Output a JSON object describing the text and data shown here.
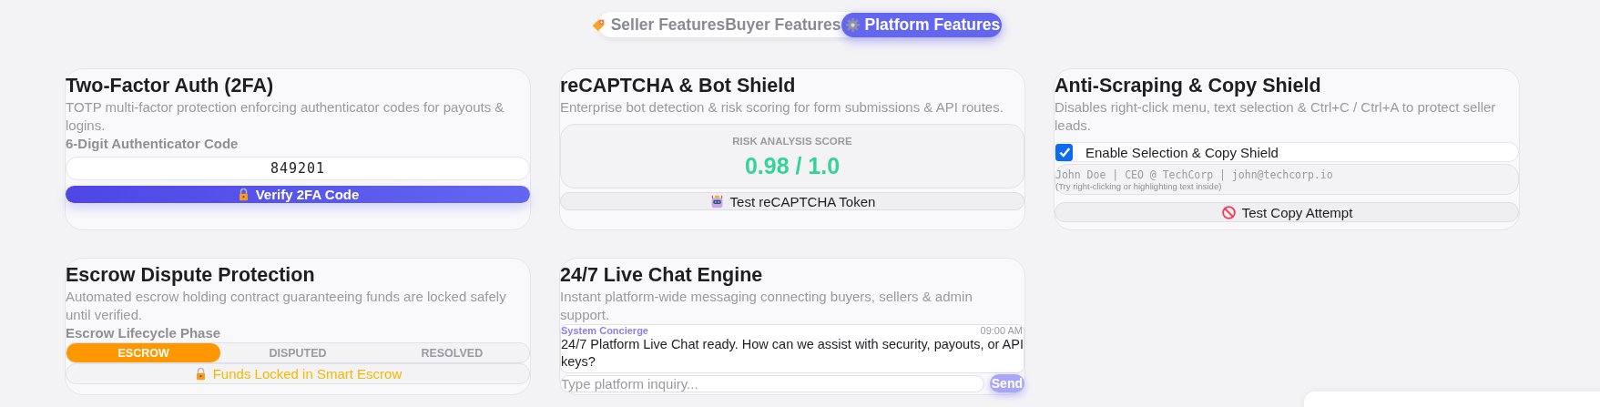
{
  "tabs": [
    {
      "label": "Seller Features",
      "selected": false
    },
    {
      "label": "Buyer Features",
      "selected": false
    },
    {
      "label": "Platform Features",
      "selected": true
    }
  ],
  "cards": [
    {
      "kind": "twofa",
      "title": "Two-Factor Auth (2FA)",
      "description": "TOTP multi-factor protection enforcing authenticator codes for payouts & logins.",
      "field_label": "6-Digit Authenticator Code",
      "code_value": "849201",
      "button": "Verify 2FA Code"
    },
    {
      "kind": "captcha",
      "title": "reCAPTCHA & Bot Shield",
      "description": "Enterprise bot detection & risk scoring for form submissions & API routes.",
      "score_label": "RISK ANALYSIS SCORE",
      "score": "0.98 / 1.0",
      "button": "Test reCAPTCHA Token"
    },
    {
      "kind": "copyshield",
      "title": "Anti-Scraping & Copy Shield",
      "description": "Disables right-click menu, text selection & Ctrl+C / Ctrl+A to protect seller leads.",
      "toggle": {
        "label": "Enable Selection & Copy Shield",
        "checked": true
      },
      "sample": "John Doe | CEO @ TechCorp | john@techcorp.io",
      "hint": "(Try right-clicking or highlighting text inside)",
      "button": "Test Copy Attempt"
    },
    {
      "kind": "escrow",
      "title": "Escrow Dispute Protection",
      "description": "Automated escrow holding contract guaranteeing funds are locked safely until verified.",
      "field_label": "Escrow Lifecycle Phase",
      "phases": [
        {
          "label": "ESCROW",
          "selected": true
        },
        {
          "label": "DISPUTED",
          "selected": false
        },
        {
          "label": "RESOLVED",
          "selected": false
        }
      ],
      "status": "Funds Locked in Smart Escrow"
    },
    {
      "kind": "chat",
      "title": "24/7 Live Chat Engine",
      "description": "Instant platform-wide messaging connecting buyers, sellers & admin support.",
      "message": {
        "sender": "System Concierge",
        "time": "09:00 AM",
        "text": "24/7 Platform Live Chat ready. How can we assist with security, payouts, or API keys?"
      },
      "input": {
        "placeholder": "Type platform inquiry..."
      },
      "send": {
        "label": "Send",
        "disabled": true
      }
    }
  ]
}
